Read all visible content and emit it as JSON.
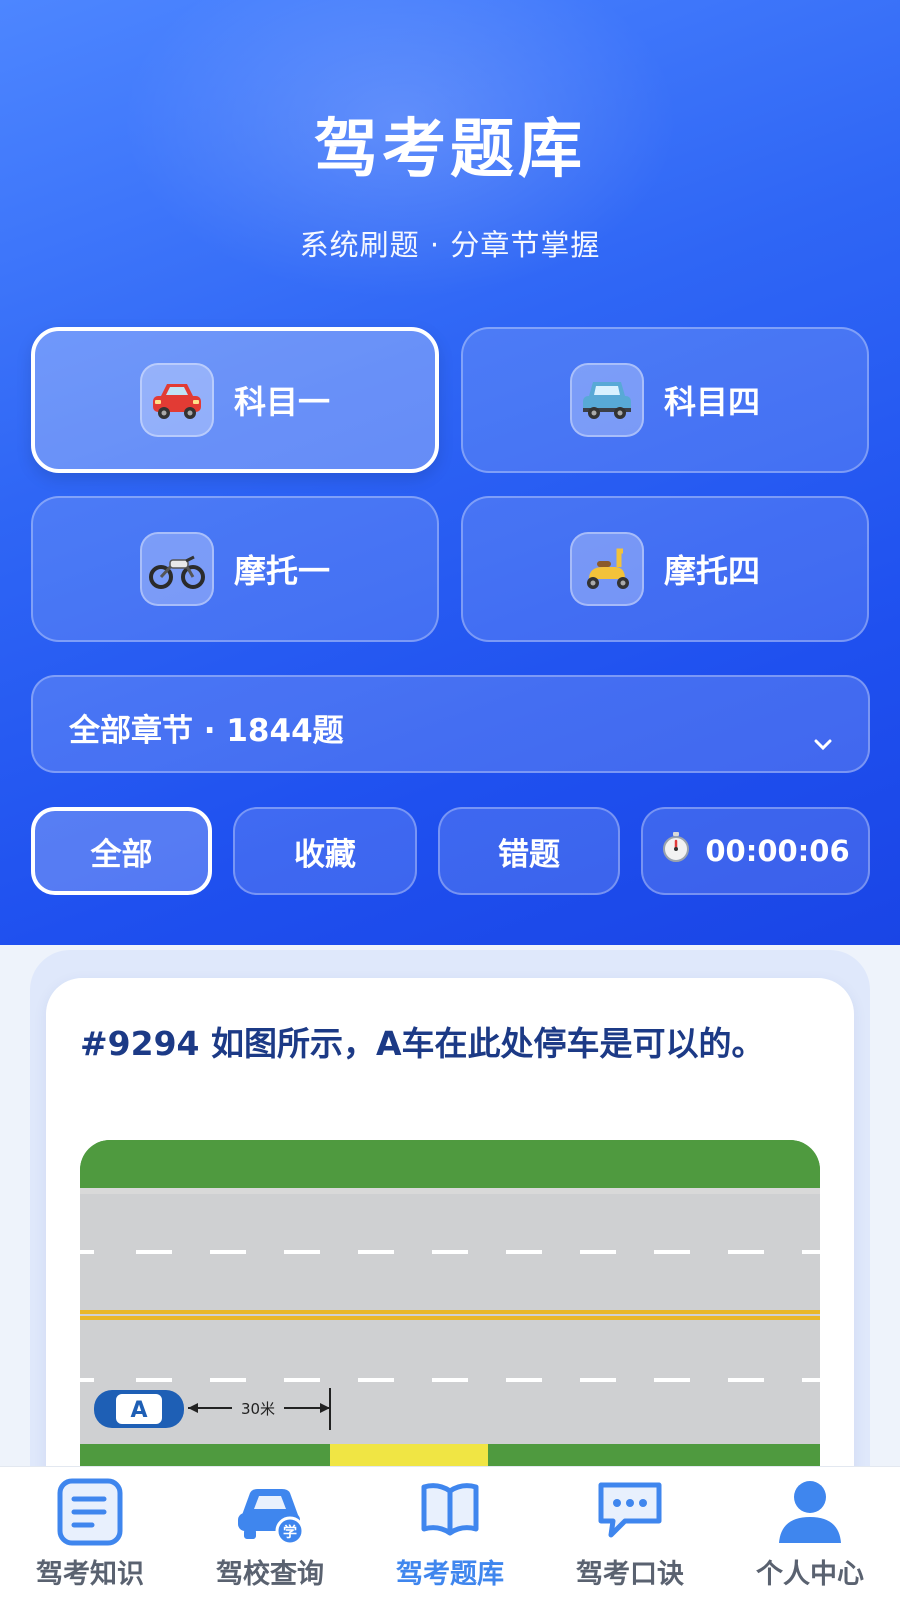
{
  "header": {
    "title": "驾考题库",
    "subtitle": "系统刷题 · 分章节掌握"
  },
  "subjects": [
    {
      "label": "科目一",
      "icon": "red-car-icon",
      "active": true
    },
    {
      "label": "科目四",
      "icon": "blue-car-icon",
      "active": false
    },
    {
      "label": "摩托一",
      "icon": "motorcycle-icon",
      "active": false
    },
    {
      "label": "摩托四",
      "icon": "scooter-icon",
      "active": false
    }
  ],
  "chapter_select": {
    "label": "全部章节 · 1844题",
    "chevron": "v"
  },
  "filters": {
    "all": "全部",
    "favorites": "收藏",
    "wrong": "错题",
    "timer": "00:00:06"
  },
  "question": {
    "text": "#9294 如图所示，A车在此处停车是可以的。",
    "image_labels": {
      "car": "A",
      "distance": "30米"
    }
  },
  "tabbar": [
    {
      "label": "驾考知识",
      "icon": "document-icon",
      "active": false
    },
    {
      "label": "驾校查询",
      "icon": "car-school-icon",
      "active": false
    },
    {
      "label": "驾考题库",
      "icon": "book-icon",
      "active": true
    },
    {
      "label": "驾考口诀",
      "icon": "chat-icon",
      "active": false
    },
    {
      "label": "个人中心",
      "icon": "user-icon",
      "active": false
    }
  ],
  "colors": {
    "primary": "#2f66f5",
    "tab_active": "#3f86ee",
    "question_text": "#1c3a86"
  }
}
